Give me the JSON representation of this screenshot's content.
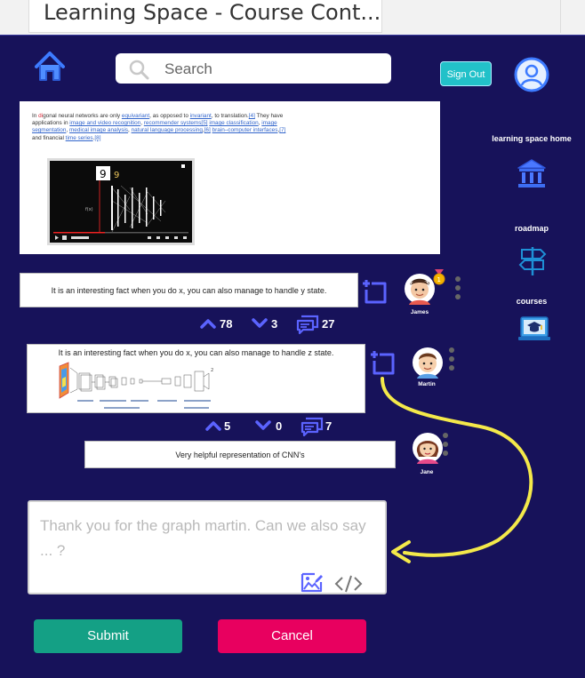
{
  "tab": {
    "title": "Learning Space - Course Cont..."
  },
  "header": {
    "search_placeholder": "Search",
    "signout_label": "Sign Out"
  },
  "sidebar": {
    "items": [
      {
        "label": "learning space home",
        "icon": "museum-icon"
      },
      {
        "label": "roadmap",
        "icon": "signpost-icon"
      },
      {
        "label": "courses",
        "icon": "laptop-graduation-icon"
      }
    ]
  },
  "doc": {
    "t1": "In ",
    "t2": "di",
    "t3": "gonal neural networks are only ",
    "l1": "equivariant",
    "t4": ", as opposed to ",
    "l2": "invariant",
    "t5": ", to translation.",
    "l3": "[4]",
    "t6": " They have applications in ",
    "l4": "image and video recognition",
    "t7": ", ",
    "l5": "recommender systems",
    "l6": "[5]",
    "t8": " ",
    "l7": "image classification",
    "t9": ", ",
    "l8": "image segmentation",
    "t10": ", ",
    "l9": "medical image analysis",
    "t11": ", ",
    "l10": "natural language processing",
    "t12": ",",
    "l11": "[6]",
    "t13": " ",
    "l12": "brain–computer interfaces",
    "t14": ",",
    "l13": "[7]",
    "t15": " and financial ",
    "l14": "time series",
    "t16": ".",
    "l15": "[8]"
  },
  "comments": [
    {
      "text": "It is an interesting fact when you do x, you can also manage to handle y state.",
      "author": "James",
      "upvotes": "78",
      "downvotes": "3",
      "replies": "27"
    },
    {
      "text": "It is an interesting fact when you do x, you can also manage to handle z state.",
      "author": "Martin",
      "upvotes": "5",
      "downvotes": "0",
      "replies": "7"
    },
    {
      "text": "Very helpful representation of CNN's",
      "author": "Jane"
    }
  ],
  "reply": {
    "text": "Thank you for the graph martin. Can we also say ... ?"
  },
  "actions": {
    "submit_label": "Submit",
    "cancel_label": "Cancel"
  },
  "colors": {
    "background": "#17125a",
    "accent": "#5b63ff",
    "submit": "#14a085",
    "cancel": "#e8005f",
    "signout": "#22c1c9",
    "annotation_arrow": "#f4e94a"
  }
}
